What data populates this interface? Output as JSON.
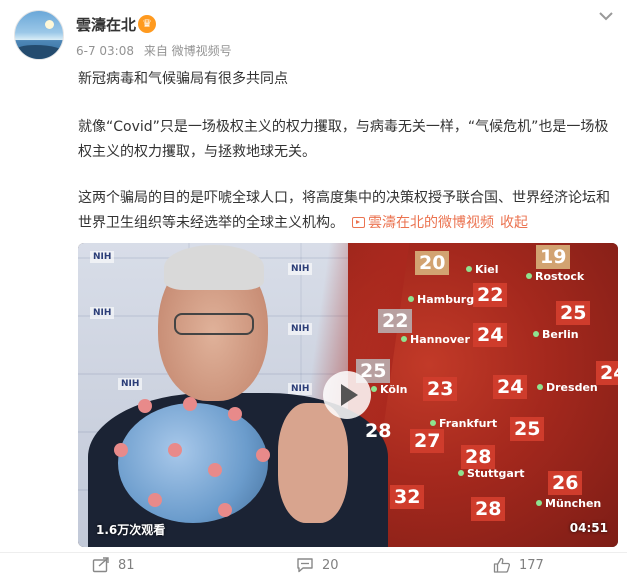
{
  "user": {
    "name": "雲濤在北",
    "badge": "♛",
    "time": "6-7 03:08",
    "source": "来自 微博视频号"
  },
  "post": {
    "line1": "新冠病毒和气候骗局有很多共同点",
    "line2": "就像“Covid”只是一场极权主义的权力攫取，与病毒无关一样，“气候危机”也是一场极权主义的权力攫取，与拯救地球无关。",
    "line3": "这两个骗局的目的是吓唬全球人口，将高度集中的决策权授予联合国、世界经济论坛和世界卫生组织等未经选举的全球主义机构。",
    "video_link": "雲濤在北的微博视频",
    "collapse": "收起"
  },
  "video": {
    "views": "1.6万次观看",
    "duration": "04:51",
    "nih_label": "NIH",
    "temps": [
      "20",
      "19",
      "22",
      "22",
      "25",
      "24",
      "25",
      "23",
      "24",
      "24",
      "28",
      "27",
      "25",
      "28",
      "32",
      "28",
      "26"
    ],
    "cities": [
      "Kiel",
      "Rostock",
      "Hamburg",
      "Hannover",
      "Berlin",
      "Köln",
      "Dresden",
      "Frankfurt",
      "Stuttgart",
      "München"
    ]
  },
  "actions": {
    "share": "81",
    "comment": "20",
    "like": "177"
  },
  "colors": {
    "accent": "#eb7350",
    "meta": "#939393"
  }
}
